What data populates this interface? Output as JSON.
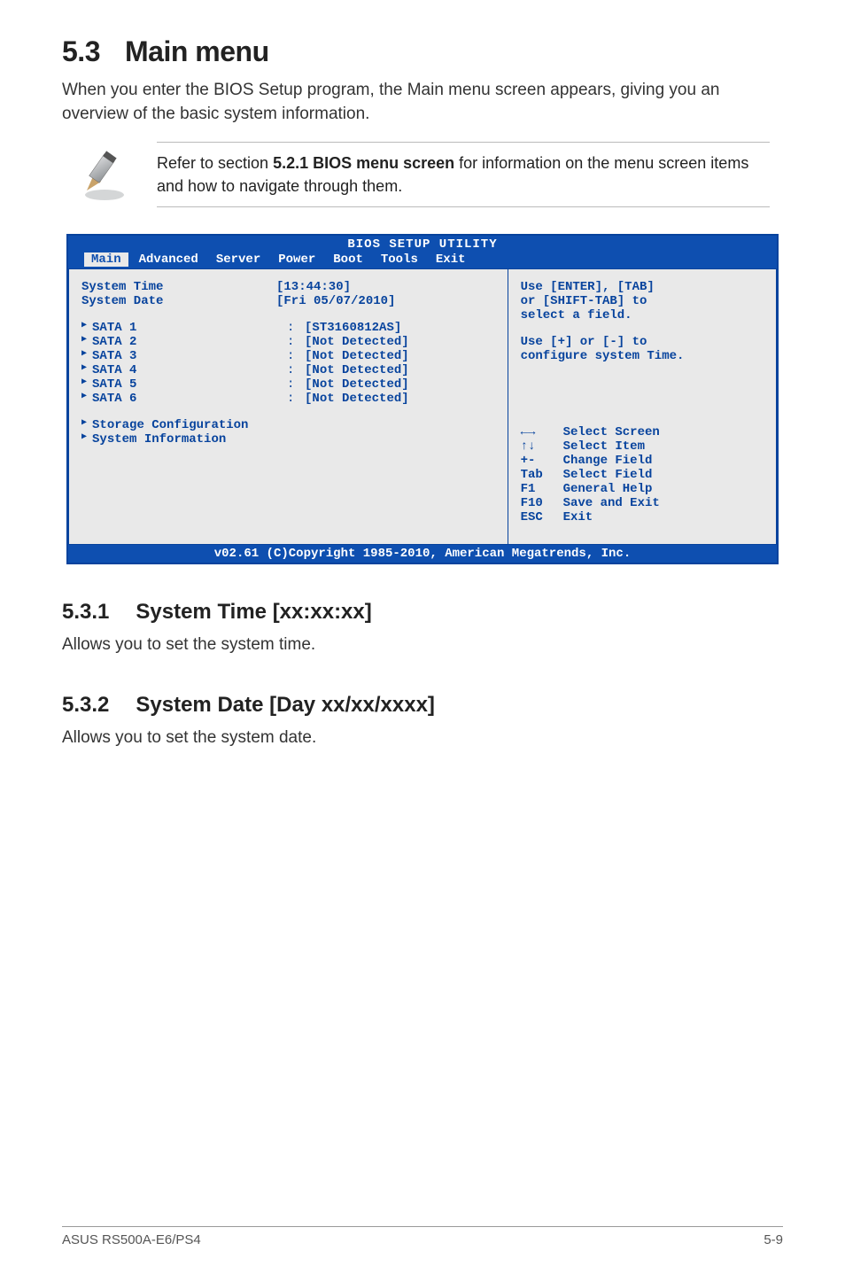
{
  "section": {
    "num": "5.3",
    "title": "Main menu"
  },
  "intro": "When you enter the BIOS Setup program, the Main menu screen appears, giving you an overview of the basic system information.",
  "note": {
    "pre": "Refer to section ",
    "bold": "5.2.1 BIOS menu screen",
    "post": " for information on the menu screen items and how to navigate through them."
  },
  "bios": {
    "title": "BIOS SETUP UTILITY",
    "tabs": [
      "Main",
      "Advanced",
      "Server",
      "Power",
      "Boot",
      "Tools",
      "Exit"
    ],
    "selected_tab": "Main",
    "fields": {
      "system_time_label": "System Time",
      "system_time_value": "[13:44:30]",
      "system_date_label": "System Date",
      "system_date_value": "[Fri 05/07/2010]",
      "sata": [
        {
          "label": "SATA 1",
          "value": "[ST3160812AS]"
        },
        {
          "label": "SATA 2",
          "value": "[Not Detected]"
        },
        {
          "label": "SATA 3",
          "value": "[Not Detected]"
        },
        {
          "label": "SATA 4",
          "value": "[Not Detected]"
        },
        {
          "label": "SATA 5",
          "value": "[Not Detected]"
        },
        {
          "label": "SATA 6",
          "value": "[Not Detected]"
        }
      ],
      "submenus": [
        "Storage Configuration",
        "System Information"
      ]
    },
    "help_top": [
      "Use [ENTER], [TAB]",
      "or [SHIFT-TAB] to",
      "select a field.",
      "",
      "Use [+] or [-] to",
      "configure system Time."
    ],
    "help_keys": [
      {
        "k": "←→",
        "d": "Select Screen"
      },
      {
        "k": "↑↓",
        "d": "Select Item"
      },
      {
        "k": "+-",
        "d": "Change Field"
      },
      {
        "k": "Tab",
        "d": "Select Field"
      },
      {
        "k": "F1",
        "d": "General Help"
      },
      {
        "k": "F10",
        "d": "Save and Exit"
      },
      {
        "k": "ESC",
        "d": "Exit"
      }
    ],
    "footer": "v02.61 (C)Copyright 1985-2010, American Megatrends, Inc."
  },
  "sub531": {
    "num": "5.3.1",
    "title": "System Time [xx:xx:xx]",
    "body": "Allows you to set the system time."
  },
  "sub532": {
    "num": "5.3.2",
    "title": "System Date [Day xx/xx/xxxx]",
    "body": "Allows you to set the system date."
  },
  "footer": {
    "left": "ASUS RS500A-E6/PS4",
    "right": "5-9"
  }
}
